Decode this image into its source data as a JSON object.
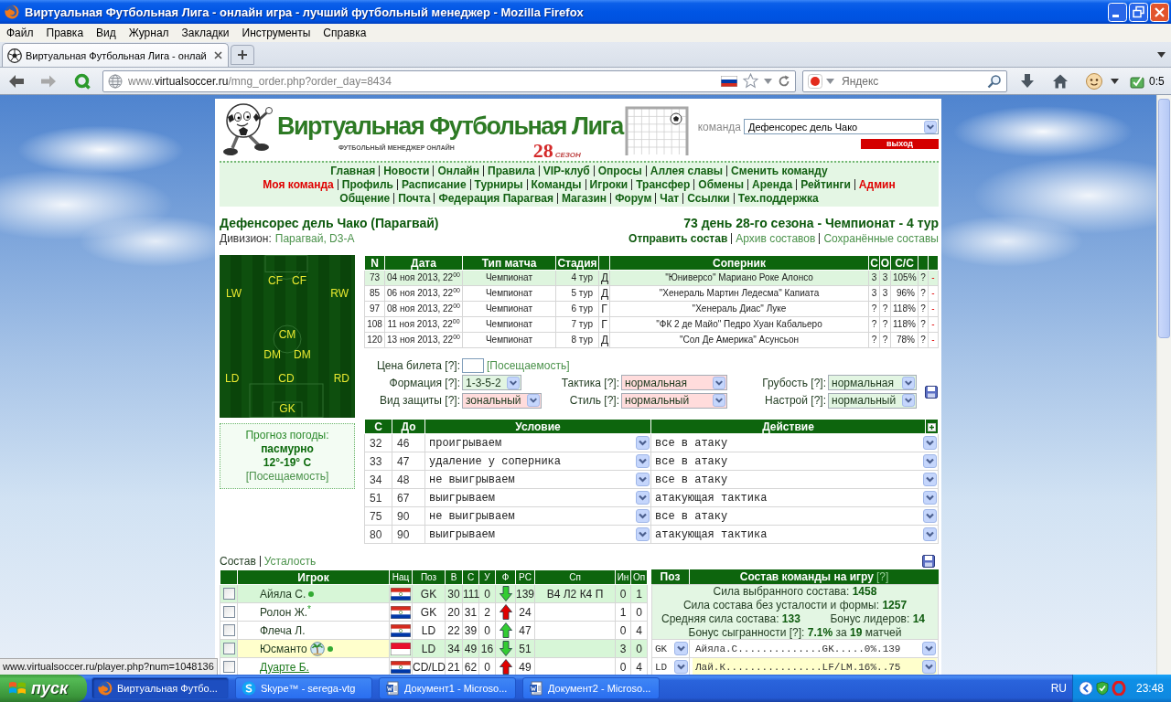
{
  "window": {
    "title": "Виртуальная Футбольная Лига - онлайн игра - лучший футбольный менеджер - Mozilla Firefox"
  },
  "menu": [
    "Файл",
    "Правка",
    "Вид",
    "Журнал",
    "Закладки",
    "Инструменты",
    "Справка"
  ],
  "tabs": [
    {
      "label": "Виртуальная Футбольная Лига - онлай",
      "selected": true
    }
  ],
  "address": {
    "prefix": "www.",
    "domain": "virtualsoccer.ru",
    "path": "/mng_order.php?order_day=8434"
  },
  "search": {
    "placeholder": "Яндекс"
  },
  "toolbar": {
    "addon_counter": "0:5"
  },
  "site": {
    "title": "Виртуальная Футбольная Лига",
    "subtitle": "ФУТБОЛЬНЫЙ МЕНЕДЖЕР ОНЛАЙН",
    "season_number": "28",
    "season_label": "СЕЗОН",
    "team_label": "команда",
    "team_select": "Дефенсорес дель Чако",
    "logout": "выход"
  },
  "nav": {
    "lines": [
      {
        "links": [
          {
            "label": "Главная",
            "highlighted": false
          },
          {
            "label": "Новости",
            "highlighted": false
          },
          {
            "label": "Онлайн",
            "highlighted": false
          },
          {
            "label": "Правила",
            "highlighted": false
          },
          {
            "label": "VIP-клуб",
            "highlighted": false
          },
          {
            "label": "Опросы",
            "highlighted": false
          },
          {
            "label": "Аллея славы",
            "highlighted": false
          },
          {
            "label": "Сменить команду",
            "highlighted": false
          }
        ]
      },
      {
        "links": [
          {
            "label": "Моя команда",
            "highlighted": true
          },
          {
            "label": "Профиль",
            "highlighted": false
          },
          {
            "label": "Расписание",
            "highlighted": false
          },
          {
            "label": "Турниры",
            "highlighted": false
          },
          {
            "label": "Команды",
            "highlighted": false
          },
          {
            "label": "Игроки",
            "highlighted": false
          },
          {
            "label": "Трансфер",
            "highlighted": false
          },
          {
            "label": "Обмены",
            "highlighted": false
          },
          {
            "label": "Аренда",
            "highlighted": false
          },
          {
            "label": "Рейтинги",
            "highlighted": false
          },
          {
            "label": "Админ",
            "highlighted": true
          }
        ]
      },
      {
        "links": [
          {
            "label": "Общение",
            "highlighted": false
          },
          {
            "label": "Почта",
            "highlighted": false
          },
          {
            "label": "Федерация Парагвая",
            "highlighted": false
          },
          {
            "label": "Магазин",
            "highlighted": false
          },
          {
            "label": "Форум",
            "highlighted": false
          },
          {
            "label": "Чат",
            "highlighted": false
          },
          {
            "label": "Ссылки",
            "highlighted": false
          },
          {
            "label": "Тех.поддержка",
            "highlighted": false
          }
        ]
      }
    ]
  },
  "team": {
    "name": "Дефенсорес дель Чако (Парагвай)",
    "division_label": "Дивизион:",
    "division": "Парагвай, D3-A",
    "match_day": "73 день 28-го сезона - Чемпионат - 4 тур",
    "links": [
      {
        "label": "Отправить состав",
        "selected": true
      },
      {
        "label": "Архив составов",
        "selected": false
      },
      {
        "label": "Сохранённые составы",
        "selected": false
      }
    ]
  },
  "pitch": {
    "lines": [
      {
        "positions": [
          "CF",
          "CF"
        ]
      },
      {
        "positions": [
          "LW",
          "RW"
        ]
      },
      {
        "positions": [
          "CM"
        ]
      },
      {
        "positions": [
          "DM",
          "DM"
        ]
      },
      {
        "positions": [
          "LD",
          "CD",
          "RD"
        ]
      },
      {
        "positions": [
          "GK"
        ]
      }
    ]
  },
  "weather": {
    "title": "Прогноз погоды:",
    "condition": "пасмурно",
    "temperature": "12°-19° C",
    "link": "[Посещаемость]"
  },
  "matches": {
    "columns": {
      "n": "N",
      "date": "Дата",
      "type": "Тип матча",
      "stage": "Стадия",
      "opponent": "Соперник",
      "c": "С",
      "o": "О",
      "cc": "С/С"
    },
    "rows": [
      {
        "n": "73",
        "date": "04 ноя 2013, 22$^{00}$",
        "type": "Чемпионат",
        "stage": "4 тур",
        "column_5": "Д",
        "opponent": "\"Юниверсо\" Мариано Роке Алонсо",
        "c": "3",
        "o": "3",
        "cc": "105%",
        "column_10": "?",
        "column_11": "-",
        "selected": true
      },
      {
        "n": "85",
        "date": "06 ноя 2013, 22$^{00}$",
        "type": "Чемпионат",
        "stage": "5 тур",
        "column_5": "Д",
        "opponent": "\"Хенераль Мартин Ледесма\" Капиата",
        "c": "3",
        "o": "3",
        "cc": "96%",
        "column_10": "?",
        "column_11": "-",
        "selected": false
      },
      {
        "n": "97",
        "date": "08 ноя 2013, 22$^{00}$",
        "type": "Чемпионат",
        "stage": "6 тур",
        "column_5": "Г",
        "opponent": "\"Хенераль Диас\" Луке",
        "c": "?",
        "o": "?",
        "cc": "118%",
        "column_10": "?",
        "column_11": "-",
        "selected": false
      },
      {
        "n": "108",
        "date": "11 ноя 2013, 22$^{00}$",
        "type": "Чемпионат",
        "stage": "7 тур",
        "column_5": "Г",
        "opponent": "\"ФК 2 де Майо\" Педро Хуан Кабальеро",
        "c": "?",
        "o": "?",
        "cc": "118%",
        "column_10": "?",
        "column_11": "-",
        "selected": false
      },
      {
        "n": "120",
        "date": "13 ноя 2013, 22$^{00}$",
        "type": "Чемпионат",
        "stage": "8 тур",
        "column_5": "Д",
        "opponent": "\"Сол Де Америка\" Асунсьон",
        "c": "?",
        "o": "?",
        "cc": "78%",
        "column_10": "?",
        "column_11": "-",
        "selected": false
      }
    ]
  },
  "settings": {
    "ticket_label": "Цена билета [?]:",
    "attendance_link": "[Посещаемость]",
    "rows": [
      {
        "fields": [
          {
            "label": "Формация [?]:",
            "value": "1-3-5-2",
            "color": "#e2f5e2"
          },
          {
            "label": "Тактика [?]:",
            "value": "нормальная",
            "color": "#ffdcdc"
          },
          {
            "label": "Грубость [?]:",
            "value": "нормальная",
            "color": "#e2f5e2"
          }
        ]
      },
      {
        "fields": [
          {
            "label": "Вид защиты [?]:",
            "value": "зональный",
            "color": "#ffdcdc"
          },
          {
            "label": "Стиль [?]:",
            "value": "нормальный",
            "color": "#ffdcdc"
          },
          {
            "label": "Настрой [?]:",
            "value": "нормальный",
            "color": "#e2f5e2"
          }
        ]
      }
    ]
  },
  "conditions": {
    "columns": {
      "from": "С",
      "to": "До",
      "condition": "Условие",
      "action": "Действие"
    },
    "rows": [
      {
        "from": "32",
        "to": "46",
        "condition": "проигрываем",
        "action": "все в атаку"
      },
      {
        "from": "33",
        "to": "47",
        "condition": "удаление у соперника",
        "action": "все в атаку"
      },
      {
        "from": "34",
        "to": "48",
        "condition": "не выигрываем",
        "action": "все в атаку"
      },
      {
        "from": "51",
        "to": "67",
        "condition": "выигрываем",
        "action": "атакующая тактика"
      },
      {
        "from": "75",
        "to": "90",
        "condition": "не выигрываем",
        "action": "все в атаку"
      },
      {
        "from": "80",
        "to": "90",
        "condition": "выигрываем",
        "action": "атакующая тактика"
      }
    ]
  },
  "lineup_tabs": [
    {
      "label": "Состав",
      "selected": true
    },
    {
      "label": "Усталость",
      "selected": false
    }
  ],
  "players": {
    "columns": {
      "player": "Игрок",
      "nation": "Нац",
      "position": "Поз",
      "v": "В",
      "s": "С",
      "u": "У",
      "form": "Ф",
      "rs": "РС",
      "sp": "Сп",
      "in": "Ин",
      "op": "Оп"
    },
    "rows": [
      {
        "checked": false,
        "name": "Айяла С.",
        "badges": [
          {
            "kind": "dot"
          }
        ],
        "flag": {
          "kind": "paraguay"
        },
        "position": "GK",
        "v": "30",
        "s": "111",
        "u": "0",
        "form": {
          "kind": "down",
          "color": "#33cc33"
        },
        "rs": "139",
        "sp": "В4 Л2 К4 П",
        "in": "0",
        "op": "1",
        "selected": true,
        "highlighted": false,
        "hovered": false
      },
      {
        "checked": false,
        "name": "Ролон Ж.$^{*}$",
        "badges": [],
        "flag": {
          "kind": "paraguay"
        },
        "position": "GK",
        "v": "20",
        "s": "31",
        "u": "2",
        "form": {
          "kind": "up",
          "color": "#e00000"
        },
        "rs": "24",
        "in": "1",
        "op": "0",
        "selected": false,
        "highlighted": false,
        "hovered": false
      },
      {
        "checked": false,
        "name": "Флеча Л.",
        "badges": [],
        "flag": {
          "kind": "paraguay"
        },
        "position": "LD",
        "v": "22",
        "s": "39",
        "u": "0",
        "form": {
          "kind": "up",
          "color": "#33cc33"
        },
        "rs": "47",
        "in": "0",
        "op": "4",
        "selected": false,
        "highlighted": false,
        "hovered": false
      },
      {
        "checked": false,
        "name": "Юсманто",
        "badges": [
          {
            "kind": "palm"
          },
          {
            "kind": "dot"
          }
        ],
        "flag": {
          "kind": "indonesia"
        },
        "position": "LD",
        "v": "34",
        "s": "49",
        "u": "16",
        "form": {
          "kind": "down",
          "color": "#33cc33"
        },
        "rs": "51",
        "in": "3",
        "op": "0",
        "selected": true,
        "highlighted": true,
        "hovered": false
      },
      {
        "checked": false,
        "name": "Дуарте Б.",
        "badges": [],
        "flag": {
          "kind": "paraguay"
        },
        "position": "CD/LD",
        "v": "21",
        "s": "62",
        "u": "0",
        "form": {
          "kind": "up",
          "color": "#e00000"
        },
        "rs": "49",
        "in": "0",
        "op": "4",
        "selected": false,
        "highlighted": false,
        "hovered": true
      }
    ]
  },
  "lineup_panel": {
    "position_header": "Поз",
    "title": "Состав команды на игру",
    "help": "[?]",
    "stats": [
      {
        "items": [
          "Сила выбранного состава: **1458**"
        ]
      },
      {
        "items": [
          "Сила состава без усталости и формы: **1257**"
        ]
      },
      {
        "items": [
          "Средняя сила состава: **133**",
          "Бонус лидеров: **14**"
        ]
      },
      {
        "items": [
          "Бонус сыгранности [?]: **7.1%** за **19** матчей"
        ]
      }
    ],
    "slots": [
      {
        "position": "GK",
        "player": "Айяла.С..............GK.....0%.139",
        "highlighted": false
      },
      {
        "position": "LD",
        "player": "Лай.К................LF/LM.16%..75",
        "highlighted": true
      }
    ]
  },
  "status_bar": "www.virtualsoccer.ru/player.php?num=1048136",
  "taskbar": {
    "start": "пуск",
    "tasks": [
      {
        "label": "Виртуальная Футбо...",
        "kind": "firefox",
        "selected": true
      },
      {
        "label": "Skype™ - serega-vtg",
        "kind": "skype",
        "selected": false
      },
      {
        "label": "Документ1 - Microso...",
        "kind": "word",
        "selected": false
      },
      {
        "label": "Документ2 - Microso...",
        "kind": "word",
        "selected": false
      }
    ],
    "language": "RU",
    "clock": "23:48"
  }
}
